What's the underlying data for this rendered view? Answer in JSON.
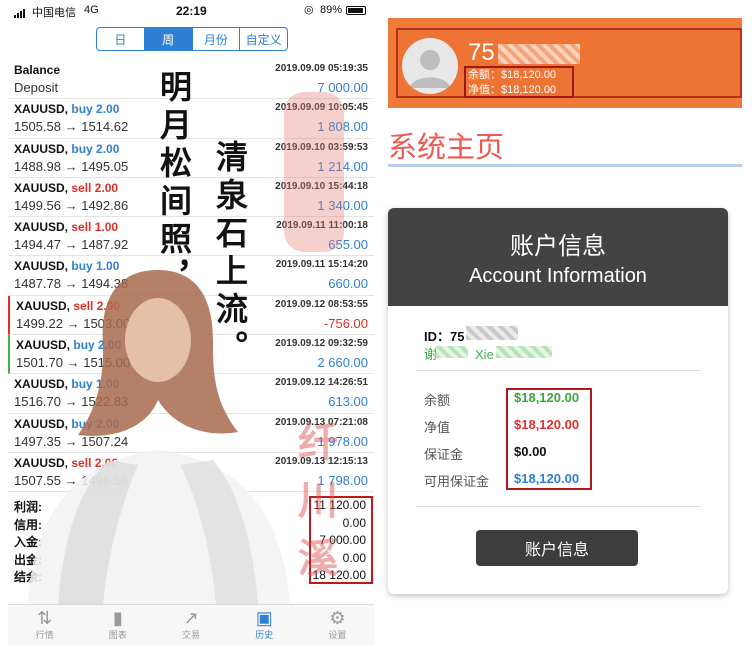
{
  "status_bar": {
    "carrier": "中国电信",
    "network": "4G",
    "time": "22:19",
    "battery": "89%"
  },
  "segments": [
    {
      "label": "日",
      "active": false
    },
    {
      "label": "周",
      "active": true
    },
    {
      "label": "月份",
      "active": false
    },
    {
      "label": "自定义",
      "active": false
    }
  ],
  "rows": [
    {
      "sym": "Balance",
      "side": "",
      "lots": "",
      "prices": "Deposit",
      "date": "2019.09.09 05:19:35",
      "pnl": "7 000.00",
      "neg": false,
      "mark": ""
    },
    {
      "sym": "XAUUSD,",
      "side": "buy",
      "lots": "2.00",
      "prices": "1505.58 → 1514.62",
      "date": "2019.09.09 10:05:45",
      "pnl": "1 808.00",
      "neg": false,
      "mark": ""
    },
    {
      "sym": "XAUUSD,",
      "side": "buy",
      "lots": "2.00",
      "prices": "1488.98 → 1495.05",
      "date": "2019.09.10 03:59:53",
      "pnl": "1 214.00",
      "neg": false,
      "mark": ""
    },
    {
      "sym": "XAUUSD,",
      "side": "sell",
      "lots": "2.00",
      "prices": "1499.56 → 1492.86",
      "date": "2019.09.10 15:44:18",
      "pnl": "1 340.00",
      "neg": false,
      "mark": ""
    },
    {
      "sym": "XAUUSD,",
      "side": "sell",
      "lots": "1.00",
      "prices": "1494.47 → 1487.92",
      "date": "2019.09.11 11:00:18",
      "pnl": "655.00",
      "neg": false,
      "mark": ""
    },
    {
      "sym": "XAUUSD,",
      "side": "buy",
      "lots": "1.00",
      "prices": "1487.78 → 1494.38",
      "date": "2019.09.11 15:14:20",
      "pnl": "660.00",
      "neg": false,
      "mark": ""
    },
    {
      "sym": "XAUUSD,",
      "side": "sell",
      "lots": "2.00",
      "prices": "1499.22 → 1503.00",
      "date": "2019.09.12 08:53:55",
      "pnl": "-756.00",
      "neg": true,
      "mark": "red"
    },
    {
      "sym": "XAUUSD,",
      "side": "buy",
      "lots": "2.00",
      "prices": "1501.70 → 1515.00",
      "date": "2019.09.12 09:32:59",
      "pnl": "2 660.00",
      "neg": false,
      "mark": "green"
    },
    {
      "sym": "XAUUSD,",
      "side": "buy",
      "lots": "1.00",
      "prices": "1516.70 → 1522.83",
      "date": "2019.09.12 14:26:51",
      "pnl": "613.00",
      "neg": false,
      "mark": ""
    },
    {
      "sym": "XAUUSD,",
      "side": "buy",
      "lots": "2.00",
      "prices": "1497.35 → 1507.24",
      "date": "2019.09.13 07:21:08",
      "pnl": "1 978.00",
      "neg": false,
      "mark": ""
    },
    {
      "sym": "XAUUSD,",
      "side": "sell",
      "lots": "2.00",
      "prices": "1507.55 → 1498.56",
      "date": "2019.09.13 12:15:13",
      "pnl": "1 798.00",
      "neg": false,
      "mark": ""
    }
  ],
  "summary": [
    {
      "label": "利润:",
      "value": "11 120.00"
    },
    {
      "label": "信用:",
      "value": "0.00"
    },
    {
      "label": "入金:",
      "value": "7 000.00"
    },
    {
      "label": "出金:",
      "value": "0.00"
    },
    {
      "label": "结余:",
      "value": "18 120.00"
    }
  ],
  "tabs": [
    {
      "label": "行情",
      "icon": "arrows-icon",
      "glyph": "⇅",
      "active": false
    },
    {
      "label": "图表",
      "icon": "candles-icon",
      "glyph": "▮",
      "active": false
    },
    {
      "label": "交易",
      "icon": "trend-icon",
      "glyph": "↗",
      "active": false
    },
    {
      "label": "历史",
      "icon": "inbox-icon",
      "glyph": "▣",
      "active": true
    },
    {
      "label": "设置",
      "icon": "gear-icon",
      "glyph": "⚙",
      "active": false
    }
  ],
  "calligraphy": {
    "col1": "明月松间照，",
    "col2": "清泉石上流。",
    "watermark": "纤川溪"
  },
  "banner": {
    "acct_prefix": "75",
    "balance_line": "余额：$18,120.00",
    "equity_line": "净值：$18,120.00"
  },
  "home": {
    "title": "系统主页"
  },
  "card": {
    "title_zh": "账户信息",
    "title_en": "Account Information",
    "id_prefix": "ID：75",
    "name_pre": "谢",
    "name_mid": "Xie",
    "rows": [
      {
        "label": "余额",
        "value": "$18,120.00",
        "color": "#3aa73a"
      },
      {
        "label": "净值",
        "value": "$18,120.00",
        "color": "#e0302a"
      },
      {
        "label": "保证金",
        "value": "$0.00",
        "color": "#111111"
      },
      {
        "label": "可用保证金",
        "value": "$18,120.00",
        "color": "#2f7fd4"
      }
    ],
    "button": "账户信息"
  }
}
